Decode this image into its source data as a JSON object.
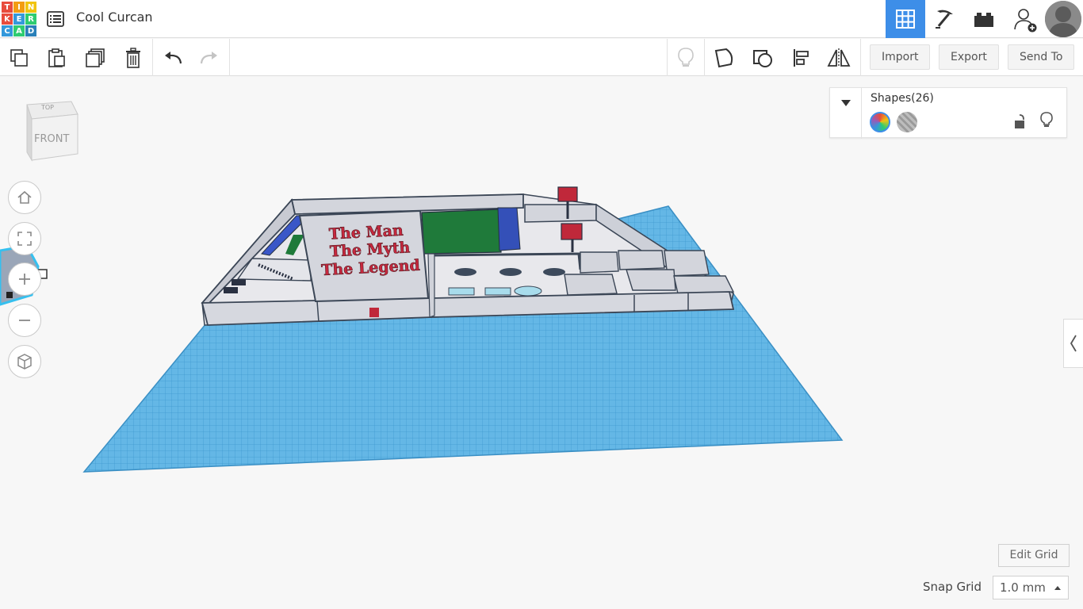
{
  "app": {
    "logo_letters": [
      "T",
      "I",
      "N",
      "K",
      "E",
      "R",
      "C",
      "A",
      "D"
    ],
    "logo_colors": [
      "#e84c3d",
      "#f39c12",
      "#f1c40f",
      "#e84c3d",
      "#3498db",
      "#2ecc71",
      "#3498db",
      "#2ecc71",
      "#2980b9"
    ],
    "project_title": "Cool Curcan"
  },
  "header": {
    "modes": [
      "3d-design-grid-icon",
      "codeblocks-pickaxe-icon",
      "bricks-icon",
      "add-user-icon"
    ],
    "active_mode": "3d-design-grid-icon",
    "accent_color": "#3d8ee8"
  },
  "toolbar": {
    "import_label": "Import",
    "export_label": "Export",
    "send_to_label": "Send To"
  },
  "viewcube": {
    "top_label": "TOP",
    "front_label": "FRONT"
  },
  "shapes_panel": {
    "title": "Shapes(26)"
  },
  "scene": {
    "sign_lines": [
      "The Man",
      "The Myth",
      "The Legend"
    ]
  },
  "grid_controls": {
    "edit_grid_label": "Edit Grid",
    "snap_grid_label": "Snap Grid",
    "snap_grid_value": "1.0 mm"
  }
}
